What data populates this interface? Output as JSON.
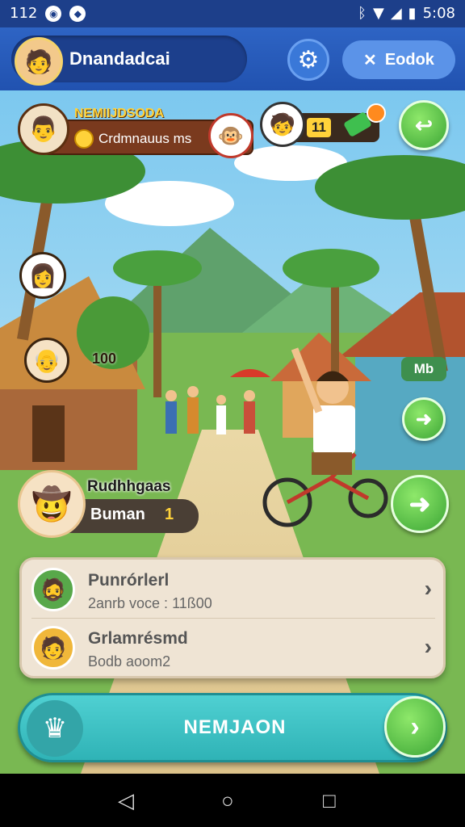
{
  "status_bar": {
    "time_left": "112",
    "time_right": "5:08"
  },
  "header": {
    "title": "Dnandadcai",
    "badge_label": "Eodok"
  },
  "hud": {
    "player_name": "NEMIIJDSODA",
    "player_sub": "Crdmnauus ms",
    "score": "11"
  },
  "markers": {
    "villager_label": "100",
    "tag": "Mb"
  },
  "player_card": {
    "title": "Rudhhgaas",
    "name": "Buman",
    "level": "1"
  },
  "list": [
    {
      "title": "Punrórlerl",
      "sub": "2anrb voce : 11ß00"
    },
    {
      "title": "Grlamrésmd",
      "sub": "Bodb aoom2"
    }
  ],
  "action": {
    "label": "NEMJAON"
  },
  "colors": {
    "header": "#2e64c4",
    "accent_green": "#3ba535",
    "action_teal": "#2fb3b6"
  },
  "icons": [
    "gear-icon",
    "crossed-tools-icon",
    "back-icon",
    "chevron-right-icon",
    "chef-hat-icon"
  ]
}
